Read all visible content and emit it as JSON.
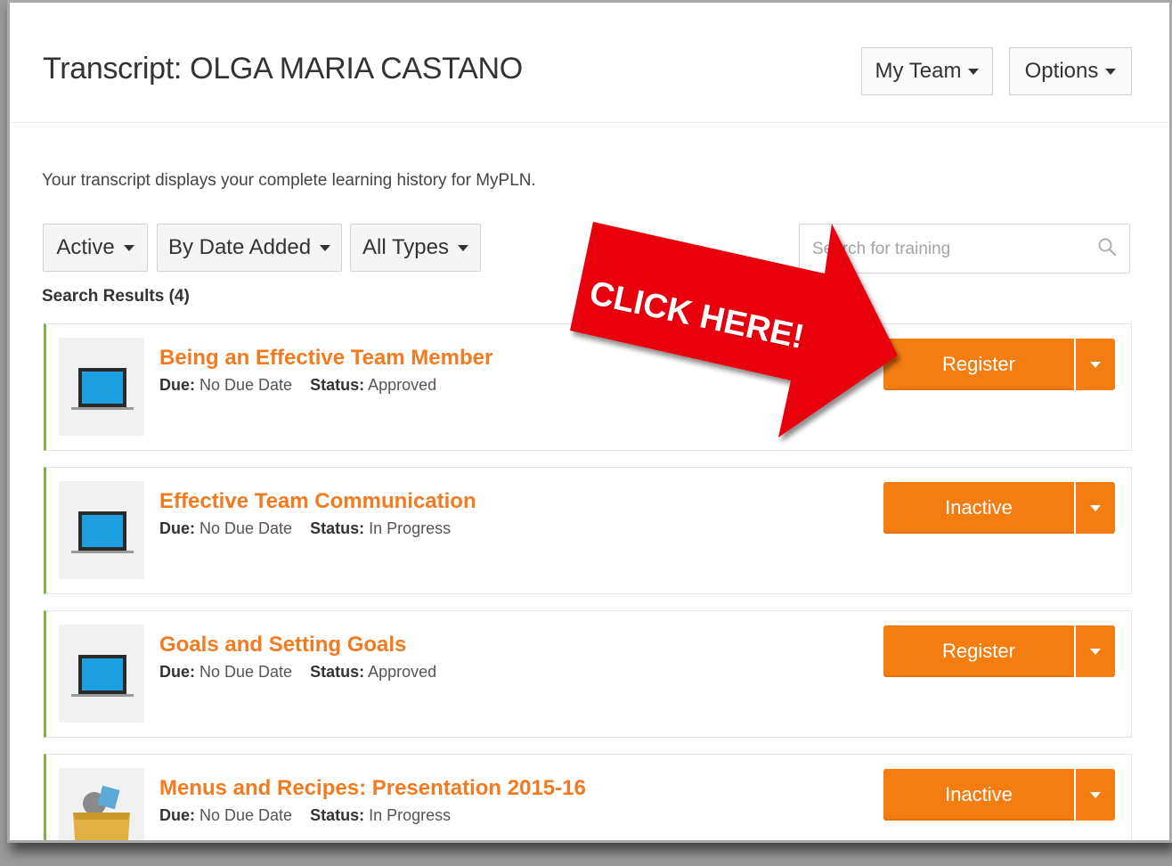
{
  "page": {
    "title": "Transcript: OLGA MARIA CASTANO",
    "description": "Your transcript displays your complete learning history for MyPLN."
  },
  "header_buttons": {
    "my_team": "My Team",
    "options": "Options"
  },
  "filters": {
    "status": "Active",
    "sort": "By Date Added",
    "types": "All Types"
  },
  "search": {
    "placeholder": "Search for training"
  },
  "results_label": "Search Results (4)",
  "labels": {
    "due": "Due:",
    "status": "Status:"
  },
  "items": [
    {
      "title": "Being an Effective Team Member",
      "due": "No Due Date",
      "status": "Approved",
      "action": "Register",
      "icon": "laptop-icon"
    },
    {
      "title": "Effective Team Communication",
      "due": "No Due Date",
      "status": "In Progress",
      "action": "Inactive",
      "icon": "laptop-icon"
    },
    {
      "title": "Goals and Setting Goals",
      "due": "No Due Date",
      "status": "Approved",
      "action": "Register",
      "icon": "laptop-icon"
    },
    {
      "title": "Menus and Recipes: Presentation 2015-16",
      "due": "No Due Date",
      "status": "In Progress",
      "action": "Inactive",
      "icon": "material-package-icon"
    }
  ],
  "annotation": {
    "text": "CLICK HERE!"
  },
  "colors": {
    "accent_orange": "#f47d12",
    "title_orange": "#f47a20",
    "card_border_green": "#7db541",
    "arrow_red": "#e8000b"
  }
}
